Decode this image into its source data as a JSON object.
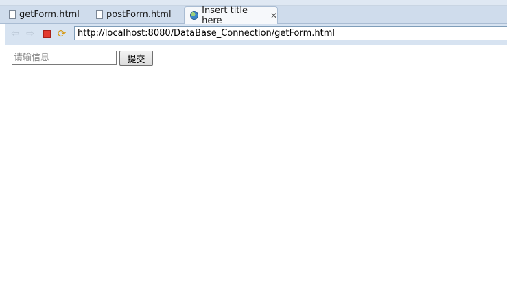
{
  "tabs": [
    {
      "label": "getForm.html",
      "icon": "document-icon",
      "active": false
    },
    {
      "label": "postForm.html",
      "icon": "document-icon",
      "active": false
    },
    {
      "label": "Insert title here",
      "icon": "globe-icon",
      "active": true
    }
  ],
  "toolbar": {
    "back_icon": "back-arrow-icon",
    "forward_icon": "forward-arrow-icon",
    "stop_icon": "stop-icon",
    "refresh_icon": "refresh-icon",
    "url": "http://localhost:8080/DataBase_Connection/getForm.html"
  },
  "form": {
    "input_placeholder": "请输信息",
    "input_value": "",
    "submit_label": "提交"
  },
  "colors": {
    "stop": "#e23a2f",
    "refresh": "#d69a16",
    "tabbar_bg": "#cfdcec"
  }
}
